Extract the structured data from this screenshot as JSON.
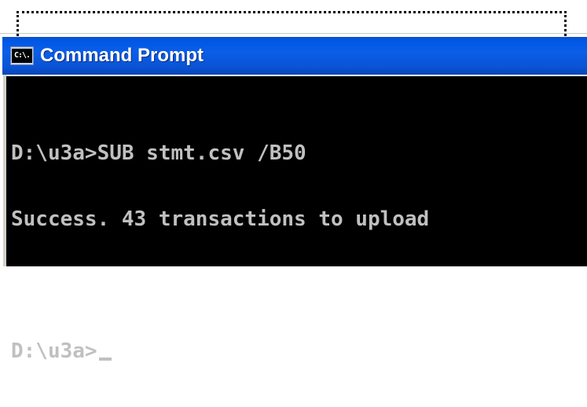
{
  "window": {
    "title": "Command Prompt",
    "icon": "cmd-icon",
    "icon_text": "C:\\."
  },
  "console": {
    "lines": [
      "D:\\u3a>SUB stmt.csv /B50",
      "Success. 43 transactions to upload",
      "",
      "D:\\u3a>"
    ]
  },
  "colors": {
    "title_bar": "#0058e6",
    "console_bg": "#000000",
    "console_text": "#c0c0c0",
    "title_text": "#ffffff"
  }
}
